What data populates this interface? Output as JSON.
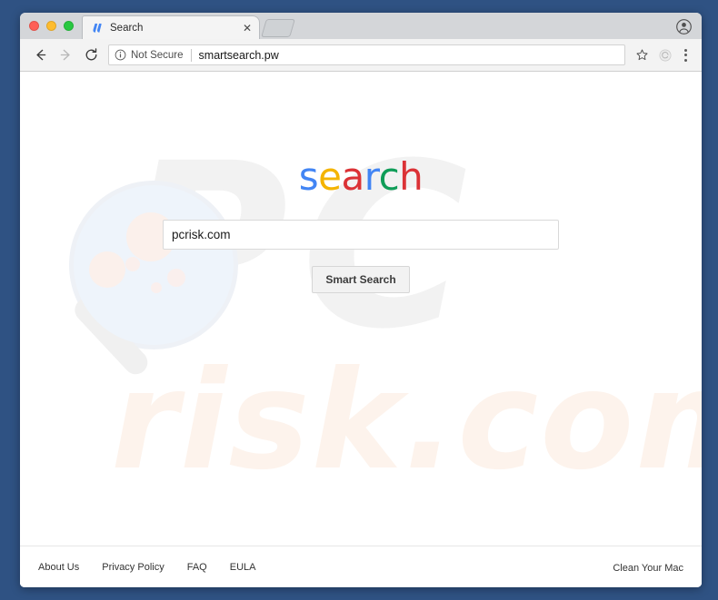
{
  "window": {
    "traffic_lights": [
      {
        "name": "close",
        "color": "#ff5f57"
      },
      {
        "name": "minimize",
        "color": "#febc2e"
      },
      {
        "name": "maximize",
        "color": "#28c840"
      }
    ]
  },
  "tab_strip": {
    "tabs": [
      {
        "title": "Search",
        "favicon": "smartsearch-favicon",
        "close_label": "✕"
      }
    ],
    "new_tab_label": "",
    "profile_icon": "account-circle-icon"
  },
  "toolbar": {
    "back_icon": "arrow-left-icon",
    "forward_icon": "arrow-right-icon",
    "reload_icon": "reload-icon",
    "security_icon": "info-circle-icon",
    "security_label": "Not Secure",
    "url": "smartsearch.pw",
    "bookmark_icon": "star-outline-icon",
    "extension_icon": "extension-circle-icon",
    "menu_icon": "three-dots-vertical-icon"
  },
  "page": {
    "watermark_top": "PC",
    "watermark_bottom": "risk.com",
    "logo": {
      "letters": [
        {
          "char": "s",
          "color": "#4285f4"
        },
        {
          "char": "e",
          "color": "#f4b400"
        },
        {
          "char": "a",
          "color": "#db3236"
        },
        {
          "char": "r",
          "color": "#4285f4"
        },
        {
          "char": "c",
          "color": "#0f9d58"
        },
        {
          "char": "h",
          "color": "#db3236"
        }
      ]
    },
    "search": {
      "value": "pcrisk.com",
      "placeholder": "",
      "button_label": "Smart Search"
    },
    "footer": {
      "links": [
        {
          "label": "About Us"
        },
        {
          "label": "Privacy Policy"
        },
        {
          "label": "FAQ"
        },
        {
          "label": "EULA"
        }
      ],
      "right_link": {
        "label": "Clean Your Mac"
      }
    }
  },
  "colors": {
    "desktop_background": "#2f5283",
    "tab_strip": "#d4d6d9",
    "toolbar": "#f3f3f3",
    "watermark_gray": "#f2f2f2",
    "watermark_peach": "#fdf3ec"
  }
}
